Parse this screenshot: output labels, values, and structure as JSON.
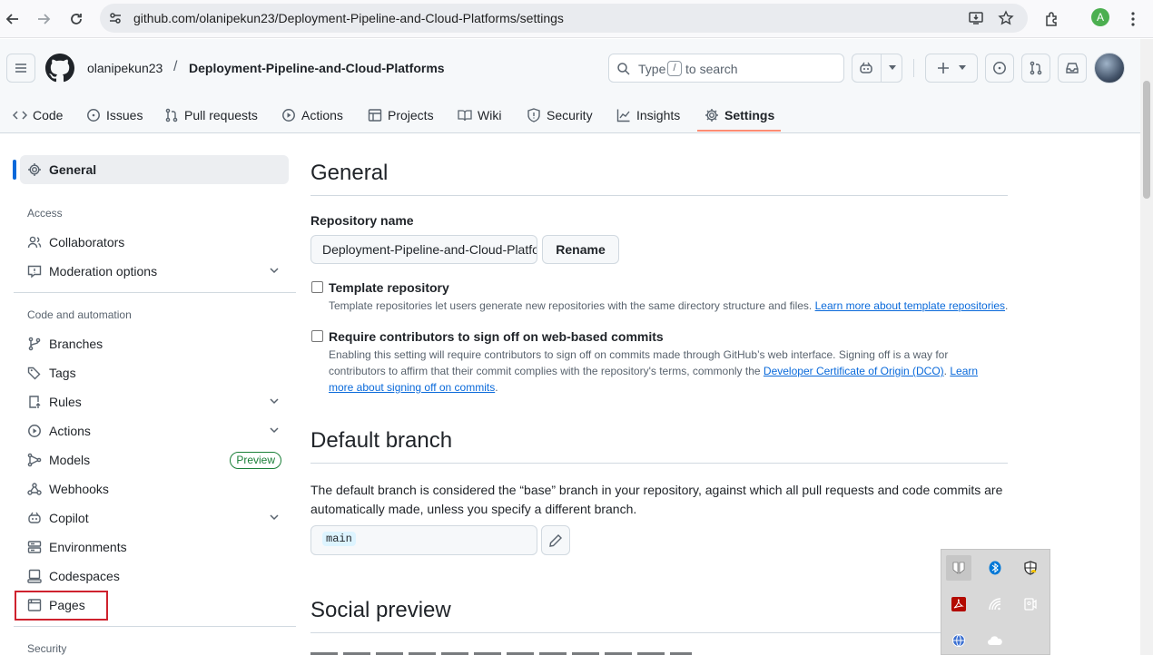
{
  "browser": {
    "url": "github.com/olanipekun23/Deployment-Pipeline-and-Cloud-Platforms/settings",
    "profile_initial": "A"
  },
  "header": {
    "owner": "olanipekun23",
    "separator": "/",
    "repo": "Deployment-Pipeline-and-Cloud-Platforms",
    "search_prefix": "Type",
    "search_key": "/",
    "search_suffix": "to search"
  },
  "repo_nav": [
    {
      "label": "Code",
      "icon": "code-icon"
    },
    {
      "label": "Issues",
      "icon": "issue-icon"
    },
    {
      "label": "Pull requests",
      "icon": "pull-request-icon"
    },
    {
      "label": "Actions",
      "icon": "play-icon"
    },
    {
      "label": "Projects",
      "icon": "table-icon"
    },
    {
      "label": "Wiki",
      "icon": "book-icon"
    },
    {
      "label": "Security",
      "icon": "shield-icon"
    },
    {
      "label": "Insights",
      "icon": "graph-icon"
    },
    {
      "label": "Settings",
      "icon": "gear-icon",
      "selected": true
    }
  ],
  "sidebar": {
    "general": "General",
    "access_heading": "Access",
    "collaborators": "Collaborators",
    "moderation": "Moderation options",
    "code_heading": "Code and automation",
    "branches": "Branches",
    "tags": "Tags",
    "rules": "Rules",
    "actions": "Actions",
    "models": "Models",
    "preview_badge": "Preview",
    "webhooks": "Webhooks",
    "copilot": "Copilot",
    "environments": "Environments",
    "codespaces": "Codespaces",
    "pages": "Pages",
    "security_heading": "Security"
  },
  "main": {
    "general_title": "General",
    "repo_name_label": "Repository name",
    "repo_name_value": "Deployment-Pipeline-and-Cloud-Platforms",
    "rename_button": "Rename",
    "template_label": "Template repository",
    "template_note": "Template repositories let users generate new repositories with the same directory structure and files.",
    "template_link": "Learn more about template repositories",
    "signoff_label": "Require contributors to sign off on web-based commits",
    "signoff_note_1": "Enabling this setting will require contributors to sign off on commits made through GitHub’s web interface. Signing off is a way for",
    "signoff_note_2": "contributors to affirm that their commit complies with the repository's terms, commonly the",
    "signoff_link_1": "Developer Certificate of Origin (DCO)",
    "signoff_link_2a": "Learn",
    "signoff_link_2b": "more about signing off on commits",
    "default_branch_title": "Default branch",
    "default_branch_desc_1": "The default branch is considered the “base” branch in your repository, against which all pull requests and code commits are",
    "default_branch_desc_2": "automatically made, unless you specify a different branch.",
    "default_branch_value": "main",
    "social_preview_title": "Social preview"
  },
  "colors": {
    "accent_underline": "#fd8c73",
    "selected_bar": "#0969da",
    "highlight_box": "#cf222e",
    "preview_green": "#1a7f37"
  }
}
